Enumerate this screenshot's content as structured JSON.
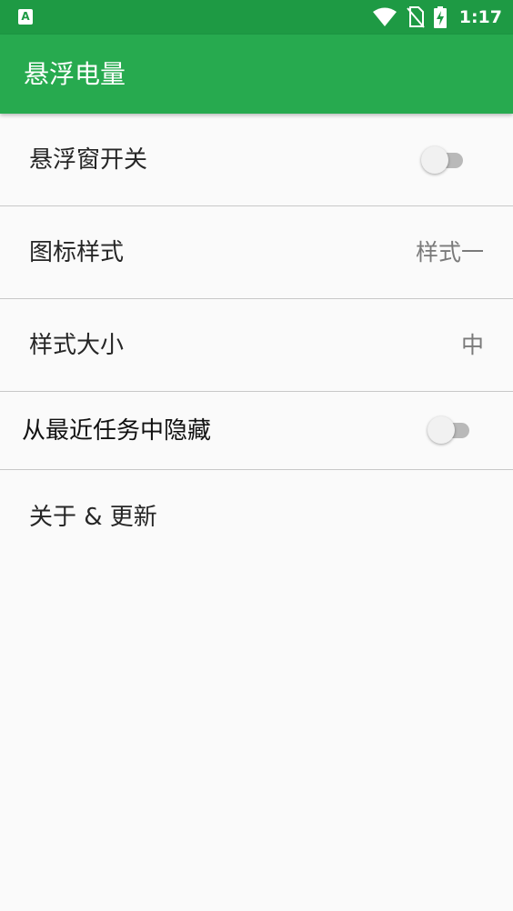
{
  "status_bar": {
    "left_icon": "A-notification-icon",
    "time": "1:17",
    "icons": [
      "wifi-icon",
      "no-sim-icon",
      "battery-charging-icon"
    ]
  },
  "app_bar": {
    "title": "悬浮电量"
  },
  "settings": {
    "floating_window": {
      "label": "悬浮窗开关",
      "enabled": false
    },
    "icon_style": {
      "label": "图标样式",
      "value": "样式一"
    },
    "style_size": {
      "label": "样式大小",
      "value": "中"
    },
    "hide_from_recents": {
      "label": "从最近任务中隐藏",
      "enabled": false
    },
    "about_update": {
      "label": "关于 & 更新"
    }
  },
  "colors": {
    "status_bar": "#1e9a44",
    "app_bar": "#27aa4f",
    "background": "#fafafa"
  }
}
